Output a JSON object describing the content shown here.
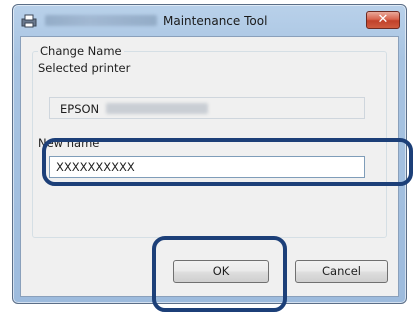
{
  "window": {
    "title": "Maintenance Tool"
  },
  "group": {
    "legend": "Change Name",
    "selected_printer_label": "Selected printer",
    "selected_printer_value": "EPSON",
    "new_name_label": "New name",
    "new_name_value": "XXXXXXXXXX"
  },
  "buttons": {
    "ok": "OK",
    "cancel": "Cancel"
  },
  "icons": {
    "app": "printer-tool-icon",
    "close": "close-icon"
  },
  "colors": {
    "highlight": "#1c3f78",
    "close_button": "#c1412a",
    "title_bar": "#a8c4e2"
  }
}
